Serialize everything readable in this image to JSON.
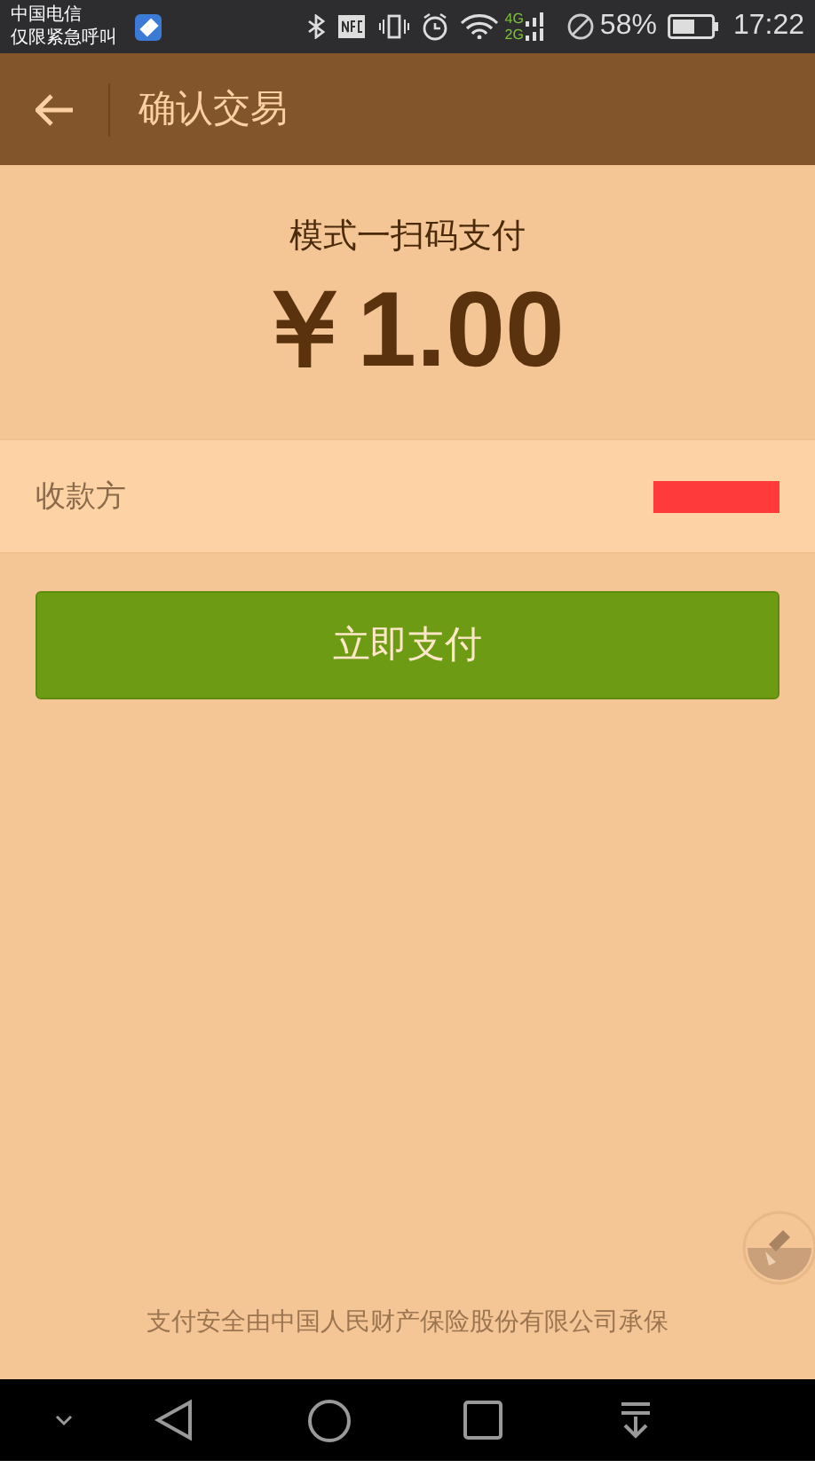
{
  "status_bar": {
    "carrier_line_1": "中国电信",
    "carrier_line_2": "仅限紧急呼叫",
    "network_top": "4G",
    "network_bottom": "2G",
    "battery": "58%",
    "time": "17:22"
  },
  "header": {
    "title": "确认交易"
  },
  "payment": {
    "mode": "模式一扫码支付",
    "amount": "￥1.00"
  },
  "payee": {
    "label": "收款方"
  },
  "pay_button": {
    "label": "立即支付"
  },
  "footer": {
    "note": "支付安全由中国人民财产保险股份有限公司承保"
  }
}
